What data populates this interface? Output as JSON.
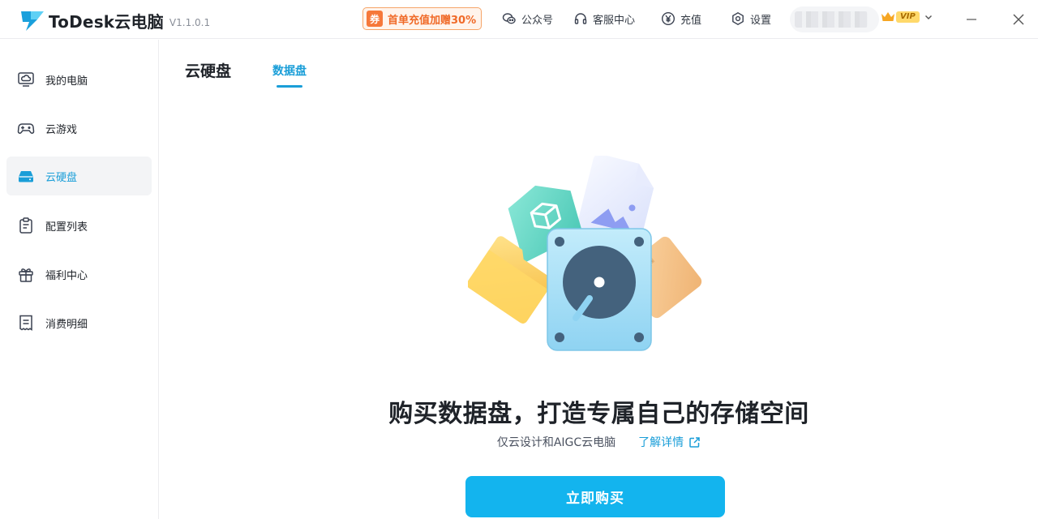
{
  "app": {
    "name": "ToDesk云电脑",
    "version": "V1.1.0.1"
  },
  "topbar": {
    "promo_badge": "券",
    "promo_text": "首单充值加赠30%",
    "items": [
      {
        "label": "公众号",
        "icon": "wechat-icon"
      },
      {
        "label": "客服中心",
        "icon": "headset-icon"
      },
      {
        "label": "充值",
        "icon": "yen-icon"
      },
      {
        "label": "设置",
        "icon": "gear-icon"
      }
    ],
    "vip_label": "VIP"
  },
  "sidebar": {
    "items": [
      {
        "label": "我的电脑",
        "icon": "monitor-cloud-icon",
        "active": false
      },
      {
        "label": "云游戏",
        "icon": "gamepad-icon",
        "active": false
      },
      {
        "label": "云硬盘",
        "icon": "hard-drive-icon",
        "active": true
      },
      {
        "label": "配置列表",
        "icon": "clipboard-icon",
        "active": false
      },
      {
        "label": "福利中心",
        "icon": "gift-icon",
        "active": false
      },
      {
        "label": "消费明细",
        "icon": "receipt-icon",
        "active": false
      }
    ]
  },
  "main": {
    "title": "云硬盘",
    "tab": "数据盘",
    "headline": "购买数据盘，打造专属自己的存储空间",
    "subtext": "仅云设计和AIGC云电脑",
    "learn_more": "了解详情",
    "buy_button": "立即购买"
  },
  "colors": {
    "accent": "#1a9ed8",
    "button": "#13b4ee",
    "promo": "#f06a28"
  }
}
